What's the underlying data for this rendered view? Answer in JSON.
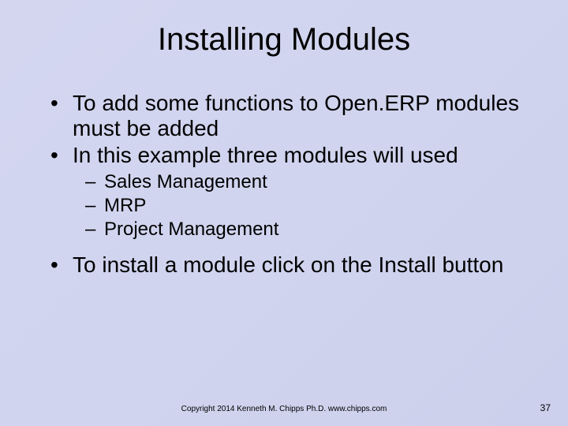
{
  "title": "Installing Modules",
  "bullets": {
    "b1": "To add some functions to Open.ERP modules must be added",
    "b2": "In this example three modules will used",
    "sub1": "Sales Management",
    "sub2": "MRP",
    "sub3": "Project Management",
    "b3": "To install a module click on the Install button"
  },
  "footer": "Copyright 2014 Kenneth M. Chipps Ph.D. www.chipps.com",
  "page_number": "37"
}
